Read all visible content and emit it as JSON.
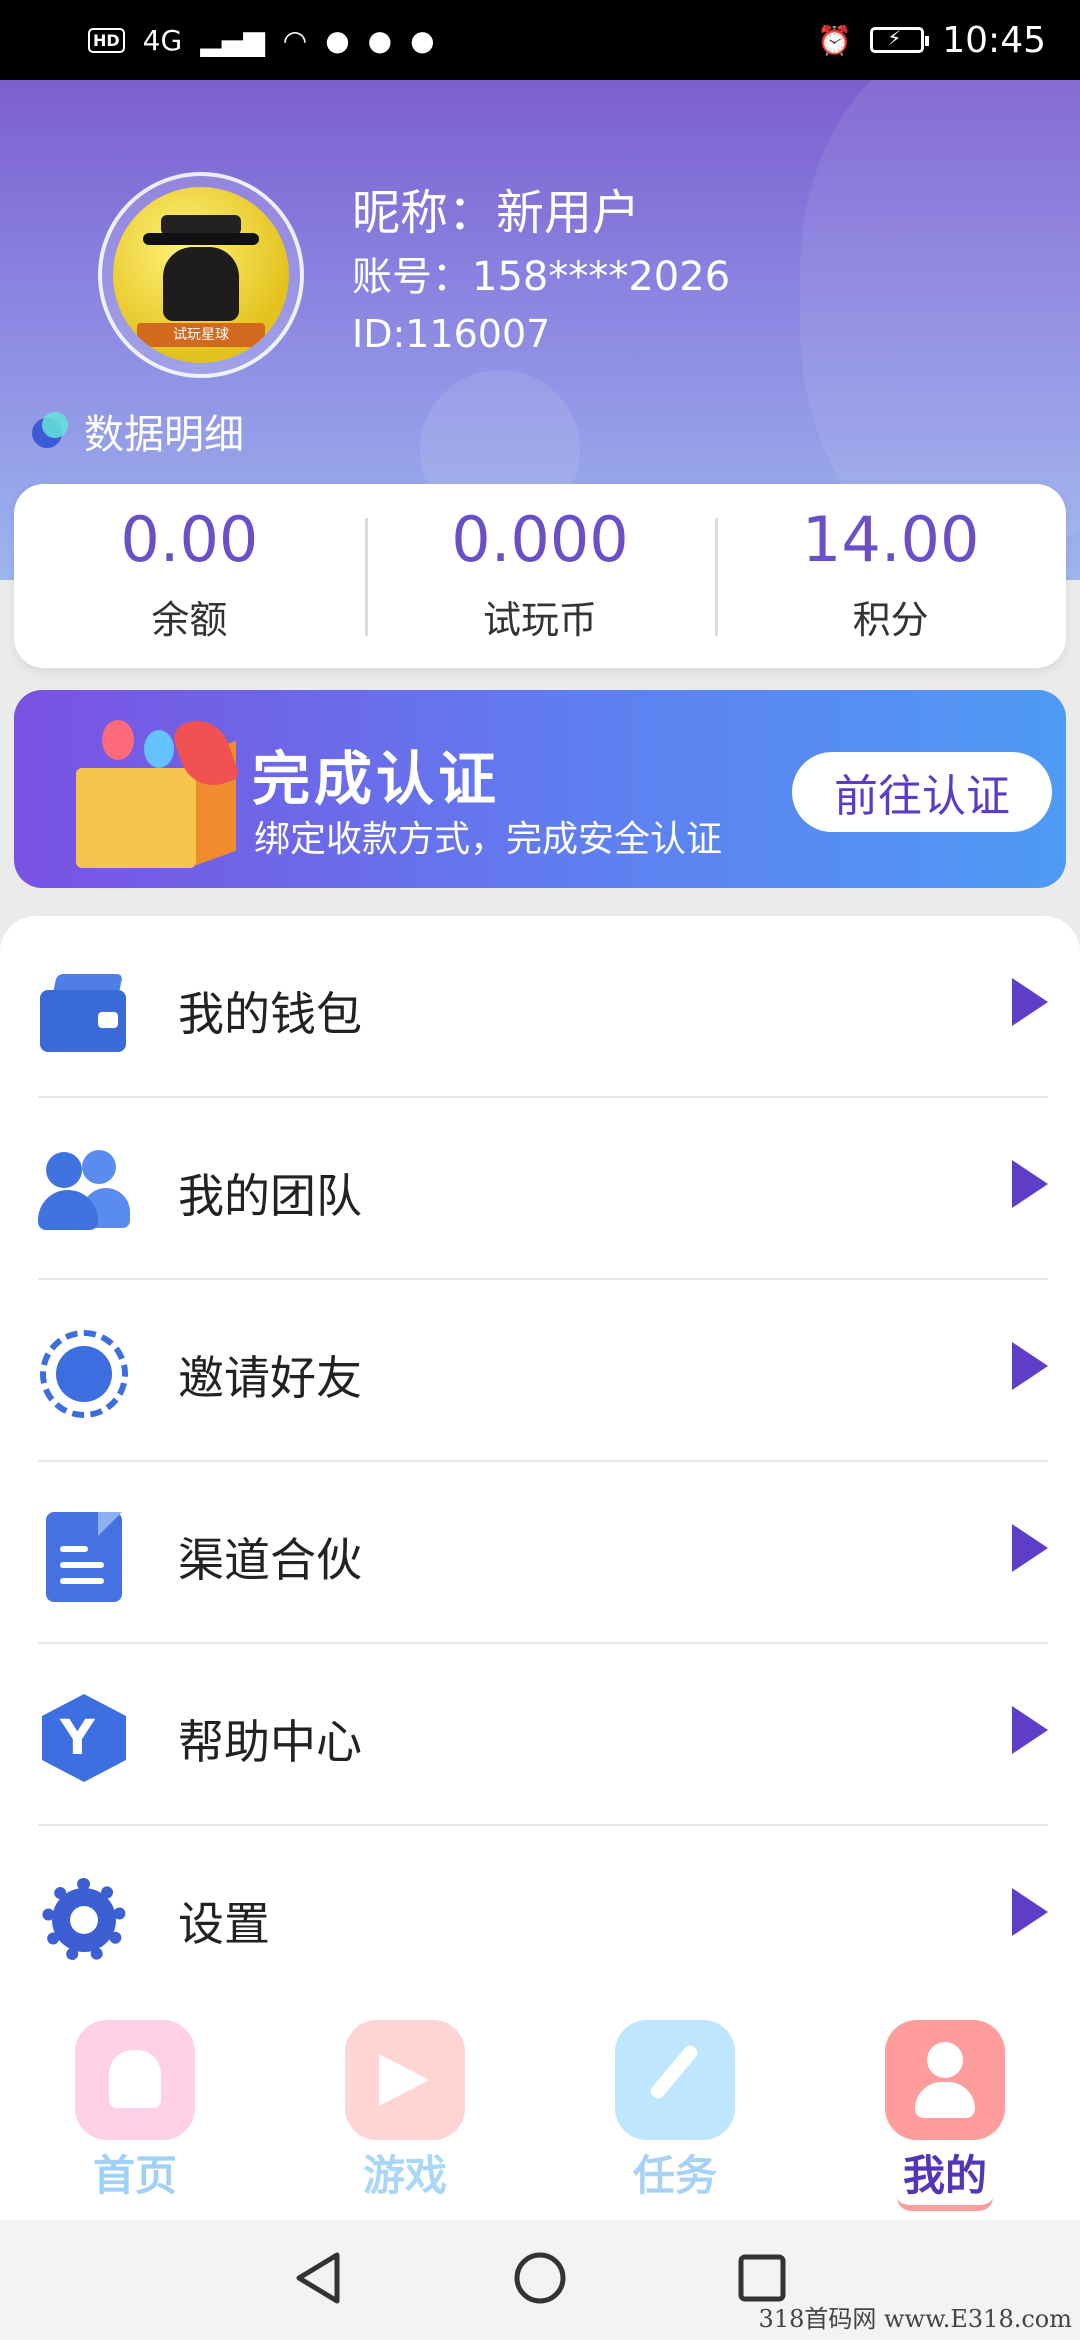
{
  "status_bar": {
    "network": "4G",
    "time": "10:45",
    "left_badge": "HD"
  },
  "profile": {
    "avatar_banner": "试玩星球",
    "nickname": "昵称：新用户",
    "account": "账号：158****2026",
    "id": "ID:116007",
    "detail_link": "数据明细"
  },
  "stats": [
    {
      "value": "0.00",
      "label": "余额"
    },
    {
      "value": "0.000",
      "label": "试玩币"
    },
    {
      "value": "14.00",
      "label": "积分"
    }
  ],
  "verify_banner": {
    "title": "完成认证",
    "subtitle": "绑定收款方式，完成安全认证",
    "button": "前往认证"
  },
  "menu": [
    {
      "label": "我的钱包",
      "icon": "wallet-icon"
    },
    {
      "label": "我的团队",
      "icon": "team-icon"
    },
    {
      "label": "邀请好友",
      "icon": "invite-icon"
    },
    {
      "label": "渠道合伙",
      "icon": "document-icon"
    },
    {
      "label": "帮助中心",
      "icon": "help-center-icon"
    },
    {
      "label": "设置",
      "icon": "gear-icon"
    }
  ],
  "tabs": [
    {
      "label": "首页",
      "icon": "home-icon"
    },
    {
      "label": "游戏",
      "icon": "game-icon"
    },
    {
      "label": "任务",
      "icon": "task-icon"
    },
    {
      "label": "我的",
      "icon": "profile-icon",
      "active": true
    }
  ],
  "watermark": "318首码网 www.E318.com",
  "colors": {
    "accent": "#5e3ec9",
    "header_top": "#7b5fcf",
    "header_bottom": "#9db6ef"
  }
}
